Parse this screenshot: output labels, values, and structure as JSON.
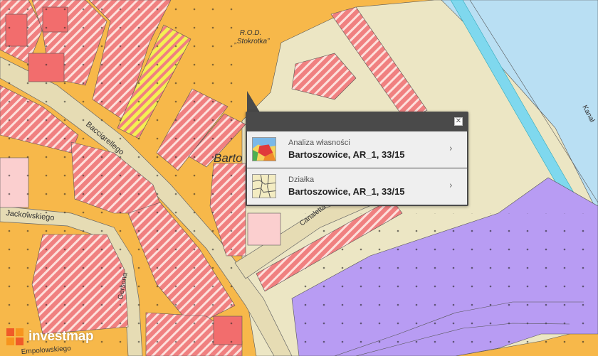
{
  "map": {
    "labels": {
      "rod_line1": "R.O.D.",
      "rod_line2": "„Stokrotka”",
      "bacciarellego": "Bacciarellego",
      "jackowskiego": "Jackowskiego",
      "gersona": "Gersona",
      "canaletta": "Canaletta",
      "bartoszowice_partial": "Barto",
      "river_partial": "Kanał",
      "bottom_street_partial": "Empolowskiego"
    },
    "colors": {
      "residential": "#f7b84a",
      "hatched_red": "#f08080",
      "hatch_white": "#fde0dc",
      "beige": "#ece6c4",
      "road": "#e6dcb4",
      "purple": "#b89cf3",
      "water": "#b9dff3",
      "pink": "#fbcfcf",
      "yellow_stripe": "#f4f053",
      "river_blue": "#7fd8ee"
    }
  },
  "popup": {
    "items": [
      {
        "category": "Analiza własności",
        "value": "Bartoszowice, AR_1, 33/15",
        "icon": "ownership-analysis-icon"
      },
      {
        "category": "Działka",
        "value": "Bartoszowice, AR_1, 33/15",
        "icon": "parcel-icon"
      }
    ],
    "close_glyph": "✕",
    "chevron_glyph": "›"
  },
  "logo": {
    "text": "investmap"
  }
}
